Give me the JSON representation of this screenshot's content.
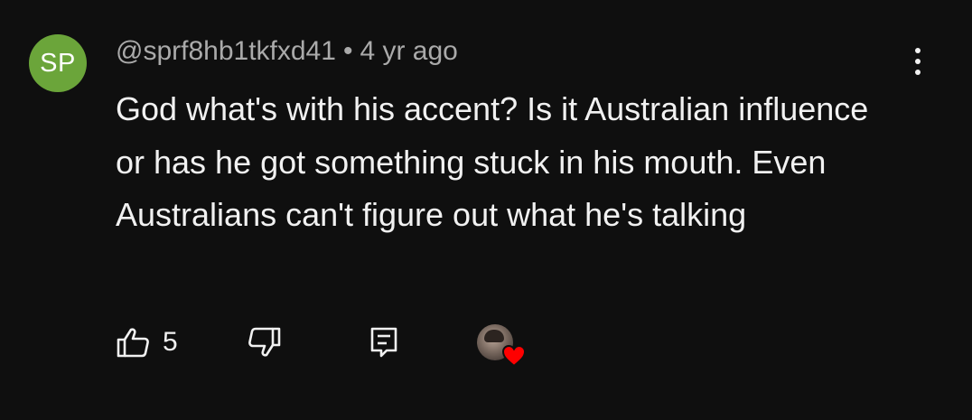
{
  "comment": {
    "avatar_initials": "SP",
    "avatar_color": "#6ba53a",
    "author": "@sprf8hb1tkfxd41",
    "separator": "•",
    "time": "4 yr ago",
    "text": "God what's with his accent? Is it Australian influence or has he got something stuck in his mouth. Even Australians can't figure out what he's talking"
  },
  "actions": {
    "like_icon": "thumbs-up-icon",
    "like_count": "5",
    "dislike_icon": "thumbs-down-icon",
    "reply_icon": "reply-icon",
    "hearted_icon": "creator-heart-icon",
    "heart_color": "#ff0000"
  },
  "menu": {
    "icon": "more-vertical-icon"
  }
}
